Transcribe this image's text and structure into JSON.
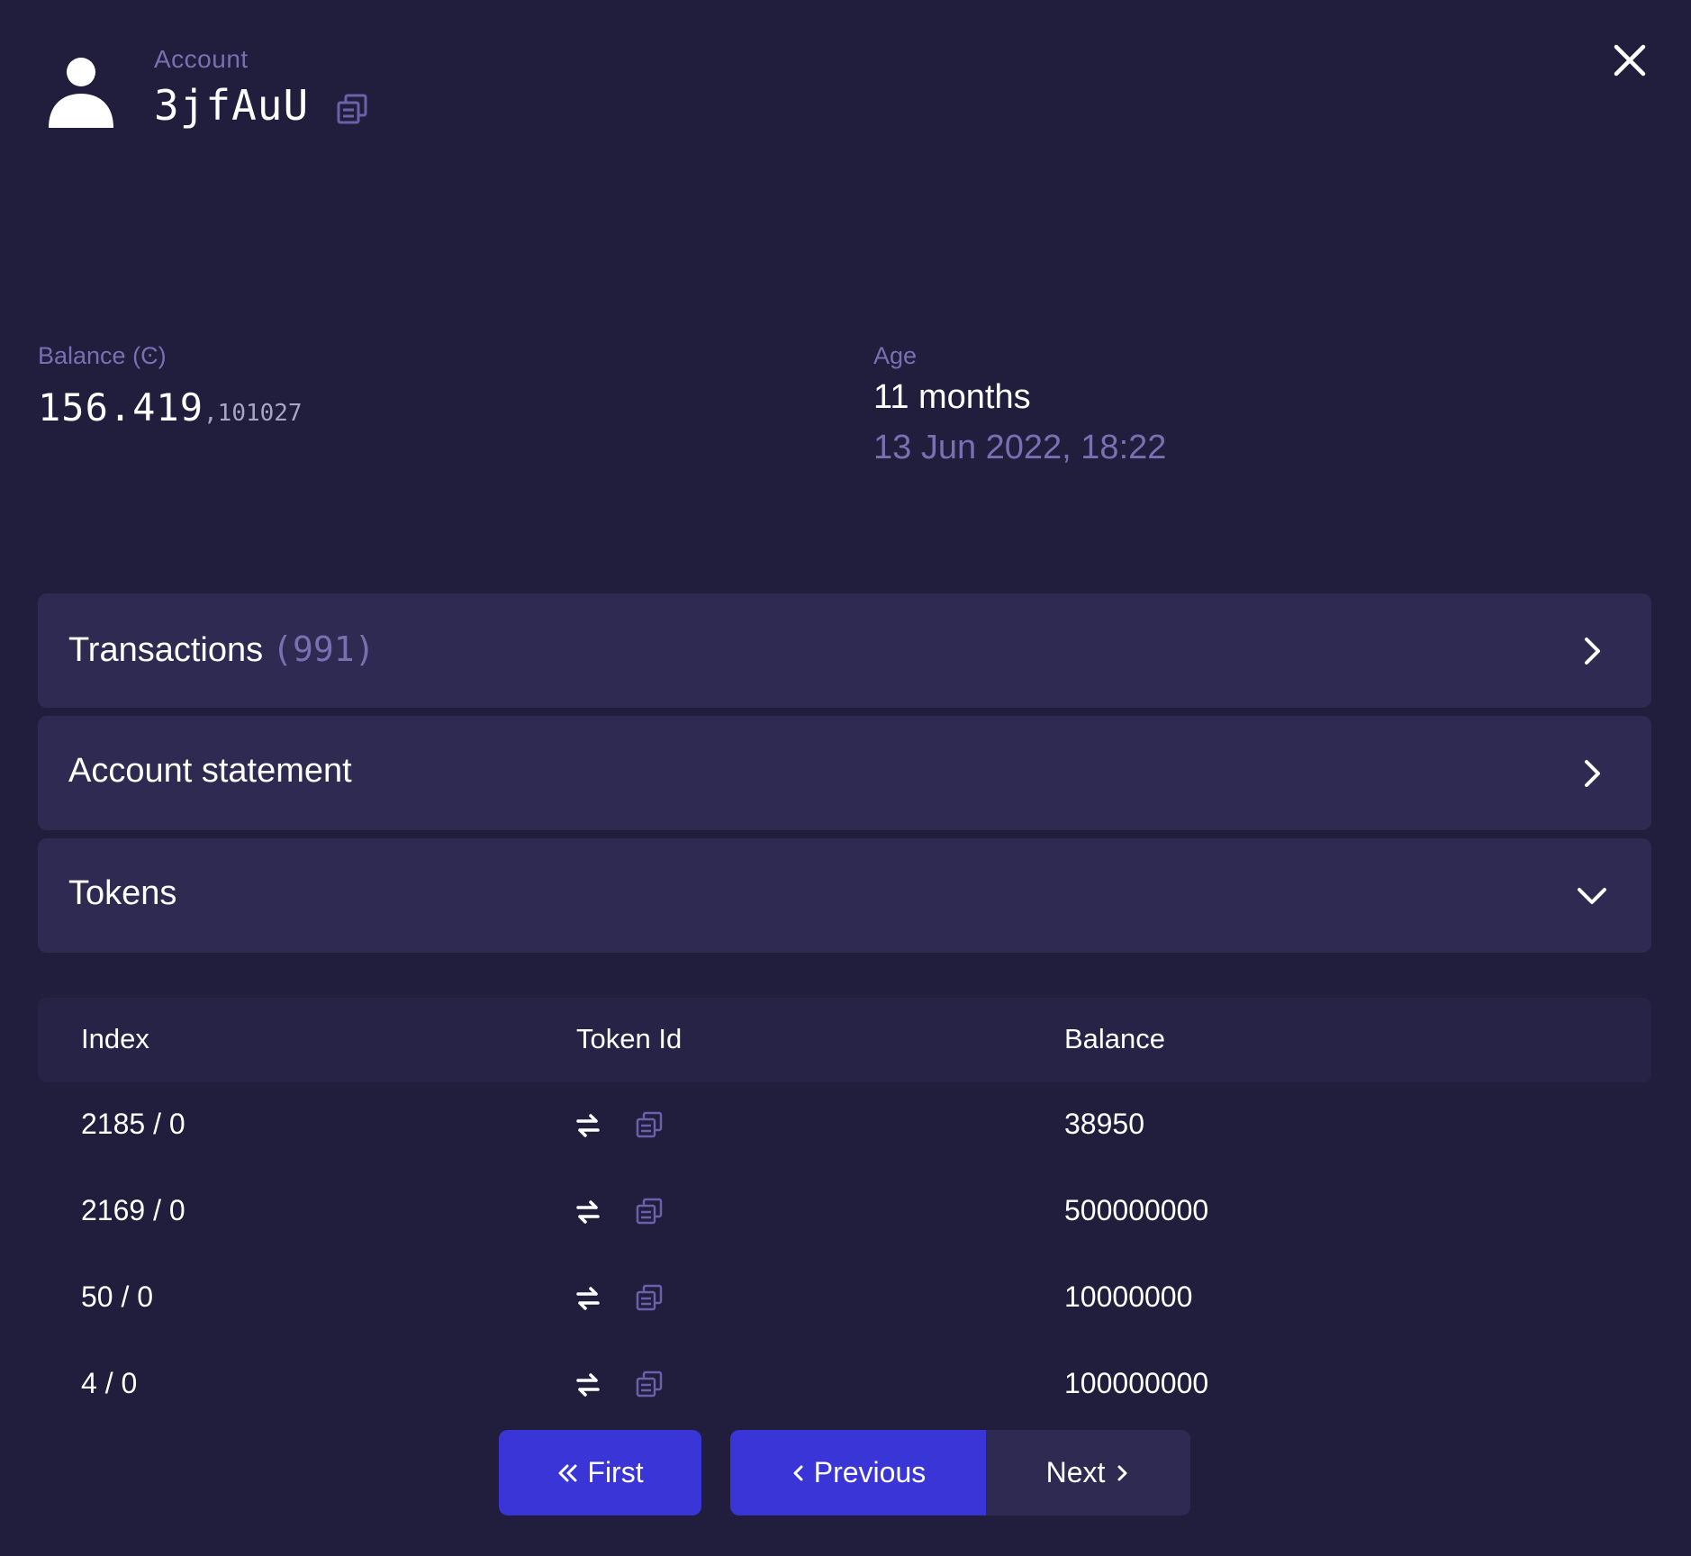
{
  "header": {
    "label": "Account",
    "address": "3jfAuU"
  },
  "balance": {
    "label": "Balance (Ͼ)",
    "main": "156.419",
    "fraction": ",101027"
  },
  "age": {
    "label": "Age",
    "value": "11 months",
    "date": "13 Jun 2022, 18:22"
  },
  "sections": {
    "transactions": {
      "label": "Transactions",
      "count": "(991)"
    },
    "statement": {
      "label": "Account statement"
    },
    "tokens": {
      "label": "Tokens"
    }
  },
  "table": {
    "columns": [
      "Index",
      "Token Id",
      "Balance"
    ],
    "rows": [
      {
        "index": "2185 / 0",
        "balance": "38950"
      },
      {
        "index": "2169 / 0",
        "balance": "500000000"
      },
      {
        "index": "50 / 0",
        "balance": "10000000"
      },
      {
        "index": "4 / 0",
        "balance": "100000000"
      }
    ]
  },
  "pagination": {
    "first": "First",
    "previous": "Previous",
    "next": "Next"
  },
  "colors": {
    "background": "#211d3d",
    "panel": "#2f2a51",
    "muted": "#7a6fb1",
    "accent": "#3a35d6"
  },
  "icons": [
    "user-icon",
    "copy-icon",
    "close-icon",
    "chevron-right-icon",
    "chevron-down-icon",
    "swap-icon",
    "double-chevron-left-icon",
    "chevron-left-icon"
  ]
}
